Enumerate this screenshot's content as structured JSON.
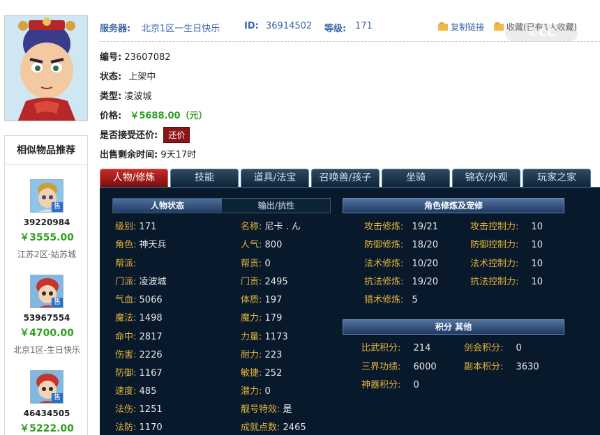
{
  "header": {
    "server_label": "服务器:",
    "server_value": "北京1区一生日快乐",
    "id_label": "ID:",
    "id_value": "36914502",
    "level_label": "等级:",
    "level_value": "171",
    "copy_link": "复制链接",
    "favorite": "收藏",
    "favorite_count": "(已有1人收藏)",
    "watermark": "©CC"
  },
  "info": {
    "number_label": "编号:",
    "number_value": "23607082",
    "status_label": "状态:",
    "status_value": "上架中",
    "type_label": "类型:",
    "type_value": "凌波城",
    "price_label": "价格:",
    "price_value": "￥5688.00（元）",
    "bargain_label": "是否接受还价:",
    "bargain_button": "还价",
    "time_label": "出售剩余时间:",
    "time_value": "9天17时"
  },
  "similar": {
    "title": "相似物品推荐",
    "sale_tag": "售",
    "items": [
      {
        "id": "39220984",
        "price": "￥3555.00",
        "server": "江苏2区-姑苏城"
      },
      {
        "id": "53967554",
        "price": "￥4700.00",
        "server": "北京1区-生日快乐"
      },
      {
        "id": "46434505",
        "price": "￥5222.00",
        "server": ""
      }
    ]
  },
  "tabs": [
    "人物/修炼",
    "技能",
    "道具/法宝",
    "召唤兽/孩子",
    "坐骑",
    "锦衣/外观",
    "玩家之家"
  ],
  "panel": {
    "subtabs": [
      "人物状态",
      "输出/抗性"
    ],
    "section_cultivation": "角色修炼及宠修",
    "section_points": "积分 其他",
    "left": [
      {
        "k": "级别:",
        "v": "171"
      },
      {
        "k": "角色:",
        "v": "神天兵"
      },
      {
        "k": "帮派:",
        "v": ""
      },
      {
        "k": "门派:",
        "v": "凌波城"
      },
      {
        "k": "气血:",
        "v": "5066"
      },
      {
        "k": "魔法:",
        "v": "1498"
      },
      {
        "k": "命中:",
        "v": "2817"
      },
      {
        "k": "伤害:",
        "v": "2226"
      },
      {
        "k": "防御:",
        "v": "1167"
      },
      {
        "k": "速度:",
        "v": "485"
      },
      {
        "k": "法伤:",
        "v": "1251"
      },
      {
        "k": "法防:",
        "v": "1170"
      }
    ],
    "mid": [
      {
        "k": "名称:",
        "v": "尼卡 . ん"
      },
      {
        "k": "人气:",
        "v": "800"
      },
      {
        "k": "帮贡:",
        "v": "0"
      },
      {
        "k": "门贡:",
        "v": "2495"
      },
      {
        "k": "体质:",
        "v": "197"
      },
      {
        "k": "魔力:",
        "v": "179"
      },
      {
        "k": "力量:",
        "v": "1173"
      },
      {
        "k": "耐力:",
        "v": "223"
      },
      {
        "k": "敏捷:",
        "v": "252"
      },
      {
        "k": "潜力:",
        "v": "0"
      },
      {
        "k": "靓号特效:",
        "v": "是"
      },
      {
        "k": "成就点数:",
        "v": "2465"
      }
    ],
    "cultivation_left": [
      {
        "k": "攻击修炼:",
        "v": "19/21"
      },
      {
        "k": "防御修炼:",
        "v": "18/20"
      },
      {
        "k": "法术修炼:",
        "v": "10/20"
      },
      {
        "k": "抗法修炼:",
        "v": "19/20"
      },
      {
        "k": "猎术修炼:",
        "v": "5"
      }
    ],
    "cultivation_right": [
      {
        "k": "攻击控制力:",
        "v": "10"
      },
      {
        "k": "防御控制力:",
        "v": "10"
      },
      {
        "k": "法术控制力:",
        "v": "10"
      },
      {
        "k": "抗法控制力:",
        "v": "10"
      }
    ],
    "points_left": [
      {
        "k": "比武积分:",
        "v": "214"
      },
      {
        "k": "三界功绩:",
        "v": "6000"
      },
      {
        "k": "神器积分:",
        "v": "0"
      }
    ],
    "points_right": [
      {
        "k": "剑会积分:",
        "v": "0"
      },
      {
        "k": "副本积分:",
        "v": "3630"
      }
    ]
  }
}
